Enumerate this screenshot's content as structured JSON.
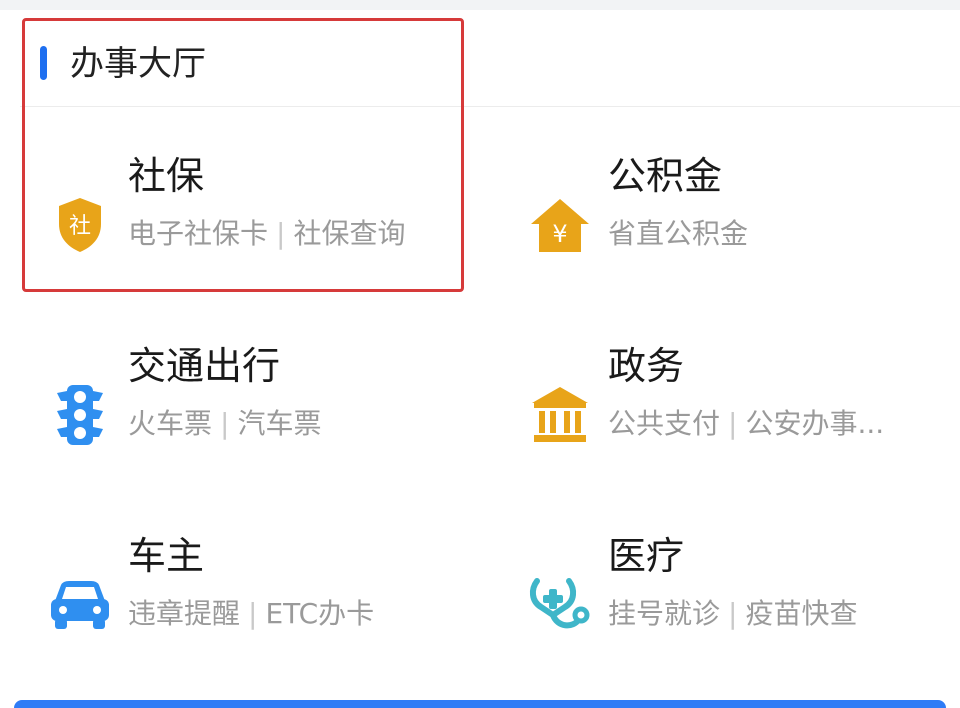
{
  "header": {
    "title": "办事大厅"
  },
  "tiles": [
    {
      "title": "社保",
      "links": [
        "电子社保卡",
        "社保查询"
      ],
      "icon": "shield-icon",
      "icon_text": "社",
      "color": "#e8a419"
    },
    {
      "title": "公积金",
      "links": [
        "省直公积金"
      ],
      "icon": "house-yuan-icon",
      "icon_text": "¥",
      "color": "#e8a419"
    },
    {
      "title": "交通出行",
      "links": [
        "火车票",
        "汽车票"
      ],
      "icon": "traffic-light-icon",
      "color": "#2f8ff0"
    },
    {
      "title": "政务",
      "links": [
        "公共支付",
        "公安办事..."
      ],
      "icon": "government-building-icon",
      "color": "#e8a419"
    },
    {
      "title": "车主",
      "links": [
        "违章提醒",
        "ETC办卡"
      ],
      "icon": "car-icon",
      "color": "#2f8ff0"
    },
    {
      "title": "医疗",
      "links": [
        "挂号就诊",
        "疫苗快查"
      ],
      "icon": "stethoscope-icon",
      "color": "#3fb6c9"
    }
  ],
  "colors": {
    "accent_blue": "#1e6ff0",
    "highlight_red": "#d63a3a",
    "text_primary": "#1a1a1a",
    "text_secondary": "#9a9a9a"
  }
}
